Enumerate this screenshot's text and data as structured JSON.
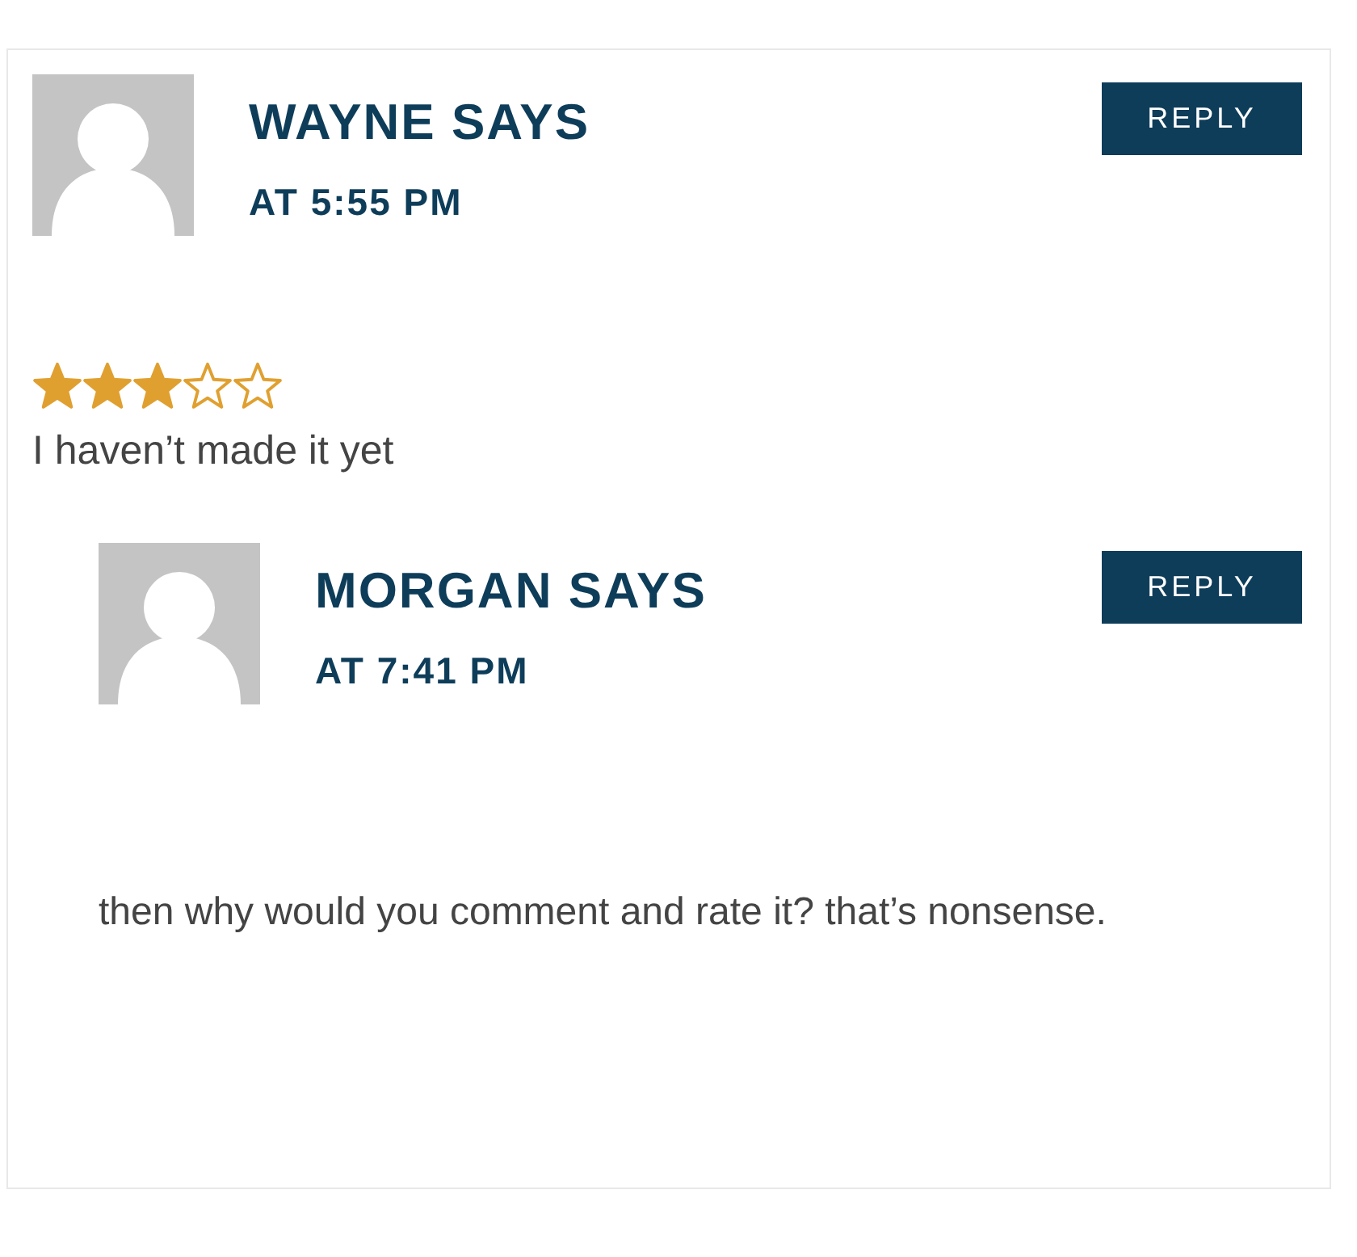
{
  "comments": [
    {
      "author": "WAYNE SAYS",
      "time": "AT 5:55 PM",
      "reply": "REPLY",
      "stars": 3,
      "text": "I haven’t made it yet",
      "children": [
        {
          "author": "MORGAN SAYS",
          "time": "AT 7:41 PM",
          "reply": "REPLY",
          "text": "then why would you comment and rate it? that’s nonsense."
        }
      ]
    }
  ]
}
